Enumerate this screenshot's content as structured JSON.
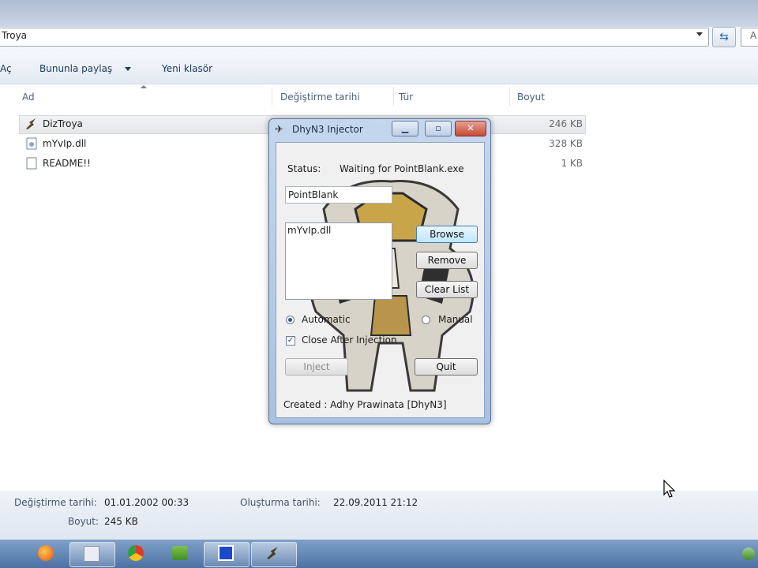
{
  "explorer": {
    "address": "Troya",
    "search_placeholder": "A",
    "toolbar": {
      "open_label": "Aç",
      "share_label": "Bununla paylaş",
      "new_folder_label": "Yeni klasör"
    },
    "columns": {
      "name": "Ad",
      "modified": "Değiştirme tarihi",
      "type": "Tür",
      "size": "Boyut"
    },
    "files": [
      {
        "name": "DizTroya",
        "size": "246 KB",
        "icon": "injector-app-icon"
      },
      {
        "name": "mYvIp.dll",
        "size": "328 KB",
        "icon": "dll-file-icon"
      },
      {
        "name": "README!!",
        "size": "1 KB",
        "icon": "text-file-icon"
      }
    ],
    "details": {
      "modified_label": "Değiştirme tarihi:",
      "modified_value": "01.01.2002 00:33",
      "size_label": "Boyut:",
      "size_value": "245 KB",
      "created_label": "Oluşturma tarihi:",
      "created_value": "22.09.2011 21:12"
    }
  },
  "injector": {
    "title": "DhyN3 Injector",
    "status_label": "Status:",
    "status_value": "Waiting for PointBlank.exe",
    "process_name": "PointBlank",
    "dll_list": [
      "mYvIp.dll"
    ],
    "browse_label": "Browse",
    "remove_label": "Remove",
    "clear_label": "Clear List",
    "automatic_label": "Automatic",
    "manual_label": "Manual",
    "close_after_label": "Close After Injection",
    "close_after_checked": true,
    "mode": "automatic",
    "inject_label": "Inject",
    "quit_label": "Quit",
    "credits": "Created : Adhy Prawinata [DhyN3]"
  },
  "colors": {
    "accent": "#3c7fb1",
    "titlebar": "#b8cde8",
    "close": "#c64a35",
    "taskbar": "#5a7fb0"
  }
}
